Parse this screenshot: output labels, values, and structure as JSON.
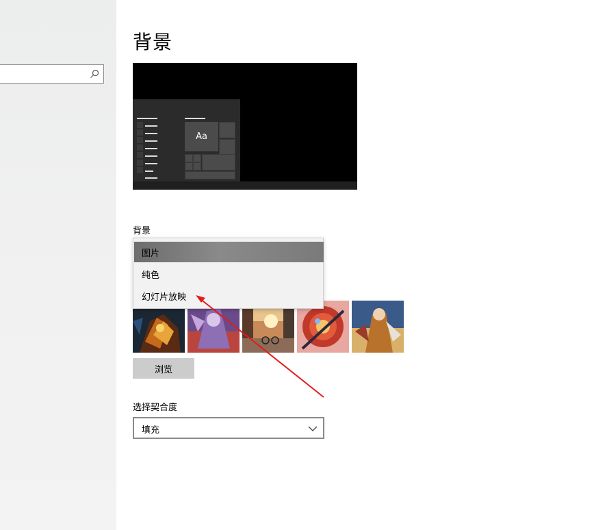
{
  "search": {
    "value": "",
    "placeholder": ""
  },
  "page": {
    "title": "背景"
  },
  "preview": {
    "tile_label": "Aa"
  },
  "background": {
    "label": "背景",
    "options": [
      "图片",
      "纯色",
      "幻灯片放映"
    ],
    "selected": "图片"
  },
  "browse": {
    "label": "浏览"
  },
  "fit": {
    "label": "选择契合度",
    "value": "填充"
  },
  "thumbnails": [
    "wallpaper-1",
    "wallpaper-2",
    "wallpaper-3",
    "wallpaper-4",
    "wallpaper-5"
  ],
  "colors": {
    "sidebar_bg": "#eeeeee",
    "selected_item": "#7d7d7d",
    "button_bg": "#cccccc",
    "annotation_arrow": "#e31b1b"
  }
}
